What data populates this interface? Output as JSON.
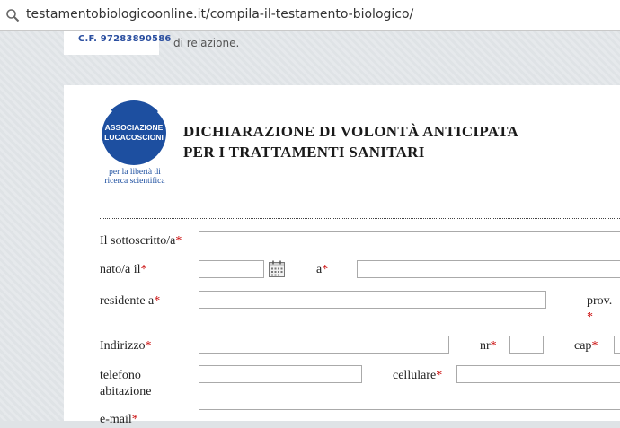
{
  "browser": {
    "url": "testamentobiologicoonline.it/compila-il-testamento-biologico/"
  },
  "header": {
    "fiscal_code": "C.F. 97283890586",
    "note_text": "di relazione."
  },
  "logo": {
    "circle_line1": "ASSOCIAZIONE",
    "circle_line2": "LUCACOSCIONI",
    "motto_line1": "per la libertà di",
    "motto_line2": "ricerca scientifica",
    "brand_color": "#1d4fa0"
  },
  "document": {
    "title_line1": "DICHIARAZIONE DI VOLONTÀ ANTICIPATA",
    "title_line2": "PER I TRATTAMENTI SANITARI"
  },
  "form": {
    "required_marker": "*",
    "fields": {
      "undersigned": {
        "label": "Il sottoscritto/a",
        "value": ""
      },
      "born_on": {
        "label": "nato/a il",
        "value": ""
      },
      "born_at": {
        "label": "a",
        "value": ""
      },
      "resident_at": {
        "label": "residente a",
        "value": ""
      },
      "province": {
        "label": "prov.",
        "value": ""
      },
      "address": {
        "label": "Indirizzo",
        "value": ""
      },
      "number": {
        "label": "nr",
        "value": ""
      },
      "zip": {
        "label": "cap",
        "value": ""
      },
      "home_phone": {
        "label_line1": "telefono",
        "label_line2": "abitazione",
        "value": ""
      },
      "mobile": {
        "label": "cellulare",
        "value": ""
      },
      "email": {
        "label": "e-mail",
        "value": ""
      }
    }
  }
}
